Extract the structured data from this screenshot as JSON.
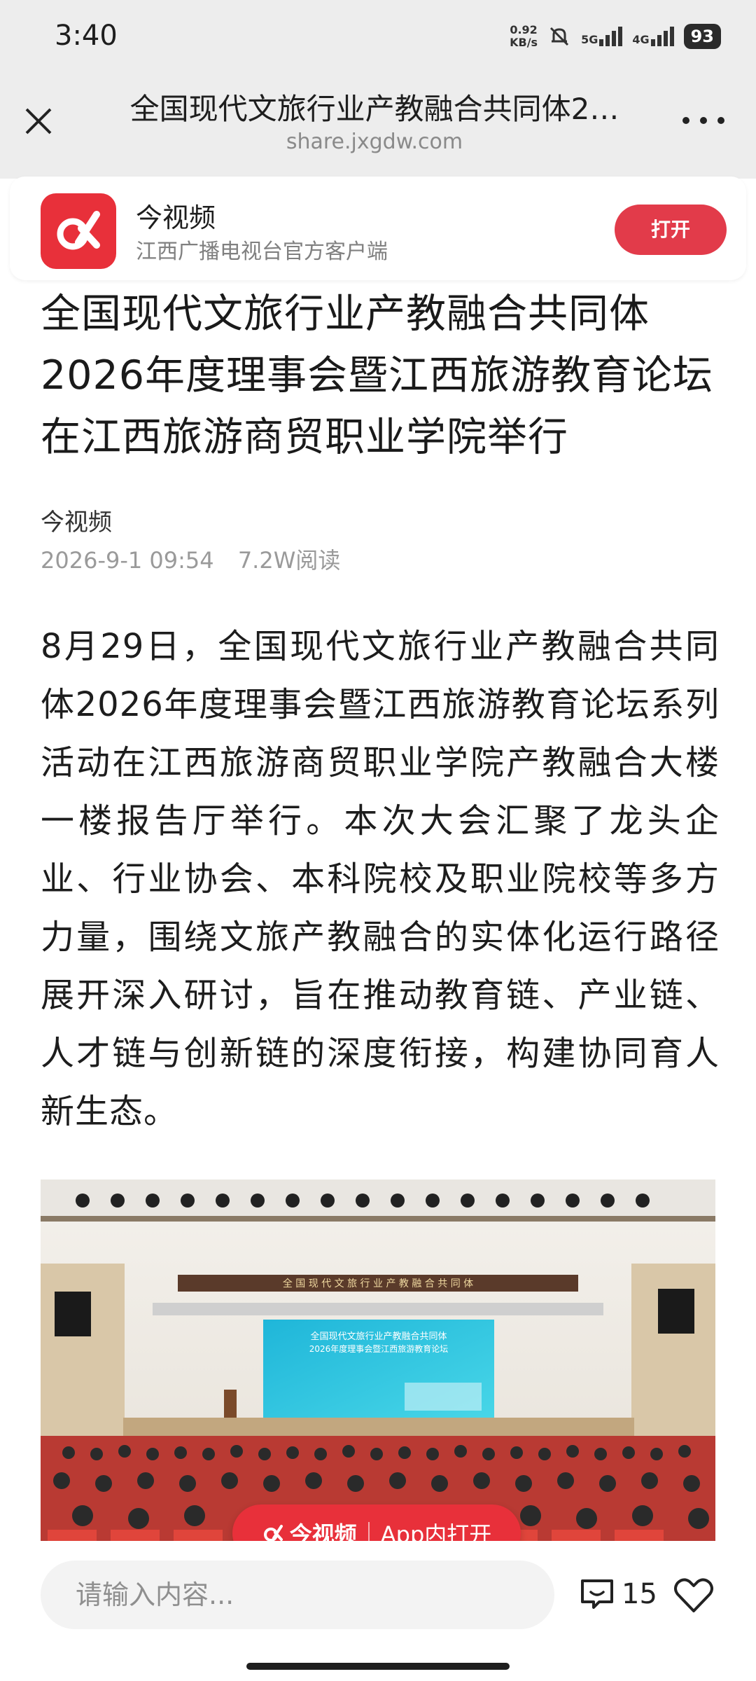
{
  "status_bar": {
    "time": "3:40",
    "net_speed_value": "0.92",
    "net_speed_unit": "KB/s",
    "sim1": "5G",
    "sim2": "4G",
    "battery": "93"
  },
  "browser": {
    "page_title": "全国现代文旅行业产教融合共同体2…",
    "domain": "share.jxgdw.com"
  },
  "app_banner": {
    "app_name": "今视频",
    "app_desc": "江西广播电视台官方客户端",
    "open_label": "打开"
  },
  "article": {
    "title": "全国现代文旅行业产教融合共同体2026年度理事会暨江西旅游教育论坛在江西旅游商贸职业学院举行",
    "author": "今视频",
    "date": "2026-9-1 09:54",
    "reads": "7.2W阅读",
    "body": "8月29日，全国现代文旅行业产教融合共同体2026年度理事会暨江西旅游教育论坛系列活动在江西旅游商贸职业学院产教融合大楼一楼报告厅举行。本次大会汇聚了龙头企业、行业协会、本科院校及职业院校等多方力量，围绕文旅产教融合的实体化运行路径展开深入研讨，旨在推动教育链、产业链、人才链与创新链的深度衔接，构建协同育人新生态。",
    "photo": {
      "banner_text": "全 国 现 代 文 旅 行 业 产 教 融 合 共 同 体",
      "screen_line1": "全国现代文旅行业产教融合共同体",
      "screen_line2": "2026年度理事会暨江西旅游教育论坛"
    }
  },
  "floating_pill": {
    "brand": "今视频",
    "action": "App内打开"
  },
  "bottom_bar": {
    "comment_placeholder": "请输入内容...",
    "comment_count": "15"
  },
  "colors": {
    "brand_red": "#e8303a",
    "header_gray": "#ededed"
  }
}
